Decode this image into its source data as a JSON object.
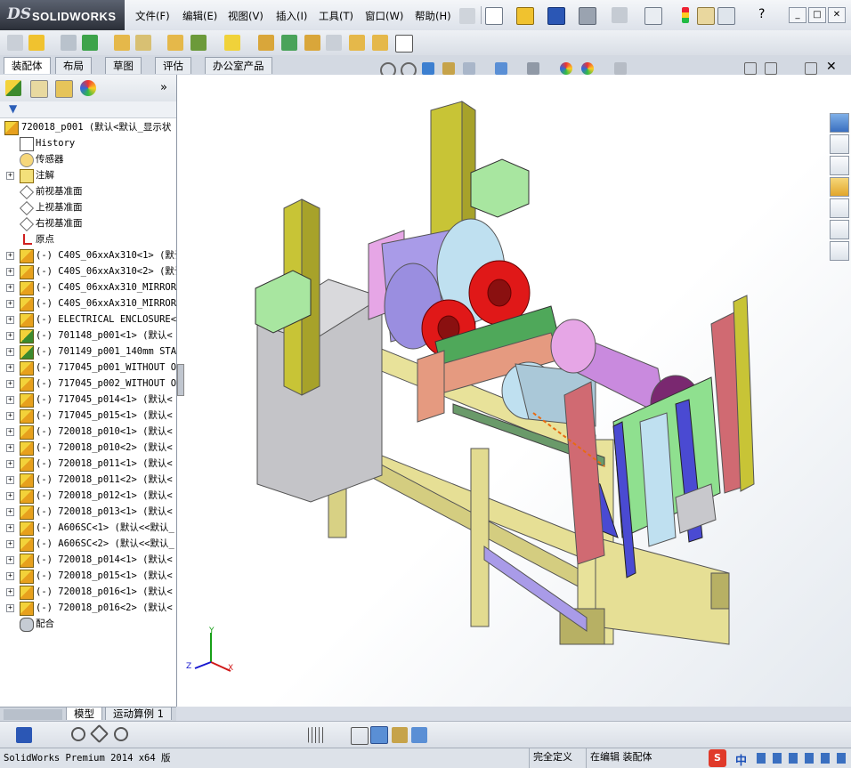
{
  "app": {
    "logo_ds": "DS",
    "logo_name": "SOLIDWORKS",
    "version_text": "SolidWorks Premium 2014 x64 版"
  },
  "menu": [
    "文件(F)",
    "编辑(E)",
    "视图(V)",
    "插入(I)",
    "工具(T)",
    "窗口(W)",
    "帮助(H)"
  ],
  "help_glyph": "?",
  "window_controls": [
    "_",
    "□",
    "✕"
  ],
  "tabs": [
    {
      "label": "装配体",
      "active": true
    },
    {
      "label": "布局",
      "active": false
    },
    {
      "label": "草图",
      "active": false
    },
    {
      "label": "评估",
      "active": false
    },
    {
      "label": "办公室产品",
      "active": false
    }
  ],
  "feature_tree": {
    "root": "720018_p001  (默认<默认_显示状",
    "items": [
      {
        "label": "History",
        "icon": "history-icon",
        "expand": false
      },
      {
        "label": "传感器",
        "icon": "sensor-icon",
        "expand": false
      },
      {
        "label": "注解",
        "icon": "annotation-icon",
        "expand": true
      },
      {
        "label": "前视基准面",
        "icon": "plane-icon",
        "expand": false
      },
      {
        "label": "上视基准面",
        "icon": "plane-icon",
        "expand": false
      },
      {
        "label": "右视基准面",
        "icon": "plane-icon",
        "expand": false
      },
      {
        "label": "原点",
        "icon": "origin-icon",
        "expand": false
      },
      {
        "label": "(-) C40S_06xxAx310<1> (默认",
        "icon": "assembly-icon",
        "expand": true
      },
      {
        "label": "(-) C40S_06xxAx310<2> (默认",
        "icon": "assembly-icon",
        "expand": true
      },
      {
        "label": "(-) C40S_06xxAx310_MIRROR<",
        "icon": "assembly-icon",
        "expand": true
      },
      {
        "label": "(-) C40S_06xxAx310_MIRROR<",
        "icon": "assembly-icon",
        "expand": true
      },
      {
        "label": "(-) ELECTRICAL ENCLOSURE<",
        "icon": "assembly-icon",
        "expand": true
      },
      {
        "label": "(-) 701148_p001<1> (默认<",
        "icon": "part-icon",
        "expand": true
      },
      {
        "label": "(-) 701149_p001_140mm STAC",
        "icon": "part-icon",
        "expand": true
      },
      {
        "label": "(-) 717045_p001_WITHOUT OI",
        "icon": "assembly-icon",
        "expand": true
      },
      {
        "label": "(-) 717045_p002_WITHOUT OI",
        "icon": "assembly-icon",
        "expand": true
      },
      {
        "label": "(-) 717045_p014<1> (默认<",
        "icon": "assembly-icon",
        "expand": true
      },
      {
        "label": "(-) 717045_p015<1> (默认<",
        "icon": "assembly-icon",
        "expand": true
      },
      {
        "label": "(-) 720018_p010<1> (默认<",
        "icon": "assembly-icon",
        "expand": true
      },
      {
        "label": "(-) 720018_p010<2> (默认<",
        "icon": "assembly-icon",
        "expand": true
      },
      {
        "label": "(-) 720018_p011<1> (默认<",
        "icon": "assembly-icon",
        "expand": true
      },
      {
        "label": "(-) 720018_p011<2> (默认<",
        "icon": "assembly-icon",
        "expand": true
      },
      {
        "label": "(-) 720018_p012<1> (默认<",
        "icon": "assembly-icon",
        "expand": true
      },
      {
        "label": "(-) 720018_p013<1> (默认<",
        "icon": "assembly-icon",
        "expand": true
      },
      {
        "label": "(-) A606SC<1> (默认<<默认_",
        "icon": "assembly-icon",
        "expand": true
      },
      {
        "label": "(-) A606SC<2> (默认<<默认_",
        "icon": "assembly-icon",
        "expand": true
      },
      {
        "label": "(-) 720018_p014<1> (默认<",
        "icon": "assembly-icon",
        "expand": true
      },
      {
        "label": "(-) 720018_p015<1> (默认<",
        "icon": "assembly-icon",
        "expand": true
      },
      {
        "label": "(-) 720018_p016<1> (默认<",
        "icon": "assembly-icon",
        "expand": true
      },
      {
        "label": "(-) 720018_p016<2> (默认<",
        "icon": "assembly-icon",
        "expand": true
      },
      {
        "label": "配合",
        "icon": "mates-icon",
        "expand": false
      }
    ]
  },
  "panel_expand": "»",
  "bottom_tabs": [
    {
      "label": "模型",
      "active": true
    },
    {
      "label": "运动算例 1",
      "active": false
    }
  ],
  "triad": {
    "x": "X",
    "y": "Y",
    "z": "Z"
  },
  "status": {
    "state": "完全定义",
    "mode": "在编辑 装配体",
    "ime": "中"
  },
  "colors": {
    "frame_yellow": "#e8e29a",
    "frame_dark": "#b7b064",
    "column_olive": "#c8c436",
    "red_coil": "#e01818",
    "enclosure_green": "#a8e6a0",
    "purple": "#a99be8",
    "pink": "#e6a6e6",
    "salmon": "#e59a80",
    "blue": "#4a4ad2",
    "rose": "#d06a72",
    "cyan": "#bfe0f0"
  }
}
